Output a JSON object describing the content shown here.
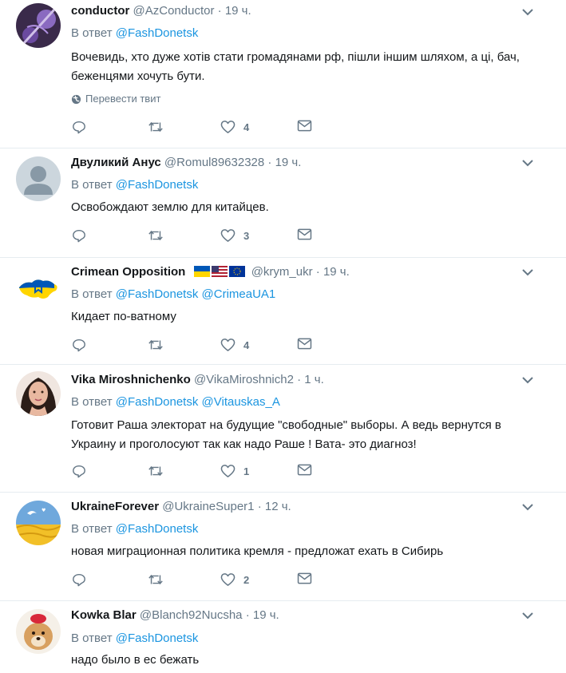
{
  "ui": {
    "reply_prefix": "В ответ",
    "translate_label": "Перевести твит"
  },
  "tweets": [
    {
      "name": "conductor",
      "handle": "@AzConductor",
      "time": "19 ч.",
      "mentions": [
        "@FashDonetsk"
      ],
      "text": "Вочевидь, хто дуже хотів стати громадянами рф, пішли іншим шляхом, а ці, бач, беженцями хочуть бути.",
      "likes": "4",
      "avatar_icon": "guitar-photo-avatar"
    },
    {
      "name": "Двуликий Анус",
      "handle": "@Romul89632328",
      "time": "19 ч.",
      "mentions": [
        "@FashDonetsk"
      ],
      "text": "Освобождают землю для китайцев.",
      "likes": "3",
      "avatar_icon": "default-user-avatar"
    },
    {
      "name": "Crimean Opposition",
      "handle": "@krym_ukr",
      "time": "19 ч.",
      "mentions": [
        "@FashDonetsk",
        "@CrimeaUA1"
      ],
      "text": "Кидает по-ватному",
      "likes": "4",
      "avatar_icon": "crimea-map-avatar",
      "flags": [
        "ukraine-flag",
        "usa-flag",
        "eu-flag"
      ]
    },
    {
      "name": "Vika Miroshnichenko",
      "handle": "@VikaMiroshnich2",
      "time": "1 ч.",
      "mentions": [
        "@FashDonetsk",
        "@Vitauskas_A"
      ],
      "text": "Готовит Раша электорат на будущие \"свободные\" выборы. А ведь вернутся в Украину и проголосуют так как надо Раше ! Вата- это диагноз!",
      "likes": "1",
      "avatar_icon": "woman-photo-avatar"
    },
    {
      "name": "UkraineForever",
      "handle": "@UkraineSuper1",
      "time": "12 ч.",
      "mentions": [
        "@FashDonetsk"
      ],
      "text": "новая миграционная политика кремля - предложат ехать в Сибирь",
      "likes": "2",
      "avatar_icon": "wheat-field-avatar"
    },
    {
      "name": "Kowka Blar",
      "handle": "@Blanch92Nucsha",
      "time": "19 ч.",
      "mentions": [
        "@FashDonetsk"
      ],
      "text": "надо было в ес бежать",
      "likes": "",
      "avatar_icon": "dog-photo-avatar"
    }
  ],
  "colors": {
    "link": "#1b95e0",
    "muted": "#657786",
    "text": "#14171a",
    "divider": "#e6ecf0"
  }
}
